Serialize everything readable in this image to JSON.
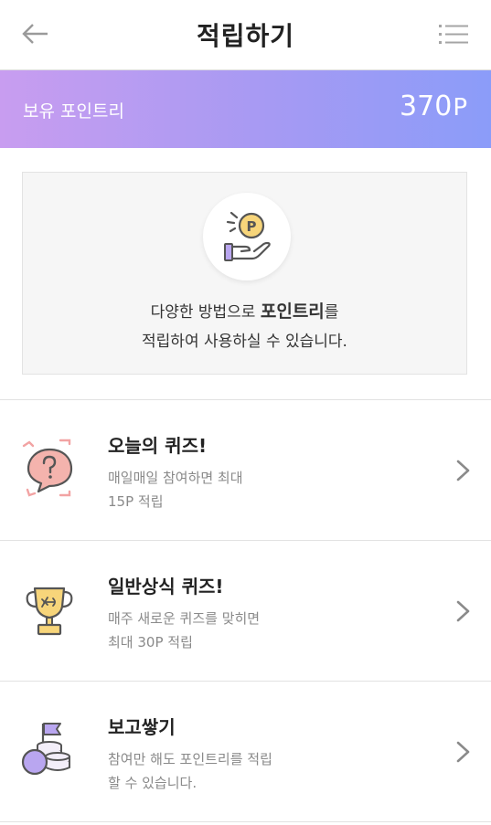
{
  "header": {
    "title": "적립하기",
    "back_icon": "arrow-left-icon",
    "menu_icon": "list-menu-icon"
  },
  "balance": {
    "label": "보유 포인트리",
    "amount": "370",
    "unit": "P"
  },
  "info": {
    "icon": "hand-coin-icon",
    "line1_prefix": "다양한 방법으로 ",
    "line1_strong": "포인트리",
    "line1_suffix": "를",
    "line2": "적립하여 사용하실 수 있습니다."
  },
  "items": [
    {
      "icon": "question-bubble-icon",
      "title": "오늘의 퀴즈!",
      "desc1": "매일매일 참여하면 최대",
      "desc2": "15P 적립"
    },
    {
      "icon": "trophy-icon",
      "title": "일반상식 퀴즈!",
      "desc1": "매주 새로운 퀴즈를 맞히면",
      "desc2": "최대 30P 적립"
    },
    {
      "icon": "coin-stack-flag-icon",
      "title": "보고쌓기",
      "desc1": "참여만 해도 포인트리를 적립",
      "desc2": "할 수 있습니다."
    }
  ],
  "colors": {
    "banner_start": "#c89df0",
    "banner_end": "#8b9cf9",
    "coin": "#f7d57a",
    "accent_purple": "#b9a6f0"
  }
}
